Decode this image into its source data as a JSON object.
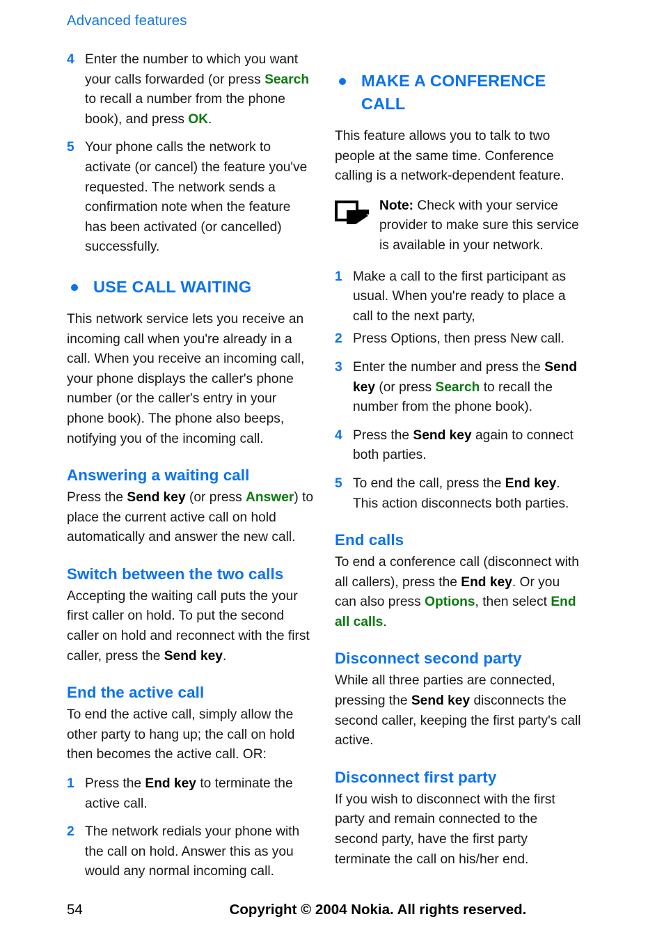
{
  "document": {
    "running_head": "Advanced features",
    "page_number": "54",
    "copyright": "Copyright © 2004 Nokia. All rights reserved.",
    "colors": {
      "heading_blue": "#0b72ee",
      "running_head_blue": "#1577e0",
      "softkey_green": "#0a7a10",
      "body_black": "#181818",
      "page_background": "#ffffff"
    }
  },
  "left_column": {
    "continued_steps": [
      {
        "number": "4",
        "segments": [
          {
            "text": "Enter the number to which you want your calls forwarded (or press ",
            "style": "normal"
          },
          {
            "text": "Search",
            "style": "green"
          },
          {
            "text": " to recall a number from the phone book), and press ",
            "style": "normal"
          },
          {
            "text": "OK",
            "style": "green"
          },
          {
            "text": ".",
            "style": "normal"
          }
        ]
      },
      {
        "number": "5",
        "segments": [
          {
            "text": "Your phone calls the network to activate (or cancel) the feature you've requested. The network sends a confirmation note when the feature has been activated (or cancelled) successfully.",
            "style": "normal"
          }
        ]
      }
    ],
    "section": {
      "title": "USE CALL WAITING",
      "intro": "This network service lets you receive an incoming call when you're already in a call. When you receive an incoming call, your phone displays the caller's phone number (or the caller's entry in your phone book). The phone also beeps, notifying you of the incoming call.",
      "subsections": [
        {
          "heading": "Answering a waiting call",
          "segments": [
            {
              "text": "Press the ",
              "style": "normal"
            },
            {
              "text": "Send key",
              "style": "bold"
            },
            {
              "text": " (or press ",
              "style": "normal"
            },
            {
              "text": "Answer",
              "style": "green"
            },
            {
              "text": ") to place the current active call on hold automatically and answer the new call.",
              "style": "normal"
            }
          ]
        },
        {
          "heading": "Switch between the two calls",
          "segments": [
            {
              "text": "Accepting the waiting call puts the your first caller on hold. To put the second caller on hold and reconnect with the first caller, press the ",
              "style": "normal"
            },
            {
              "text": "Send key",
              "style": "bold"
            },
            {
              "text": ".",
              "style": "normal"
            }
          ]
        },
        {
          "heading": "End the active call",
          "segments": [
            {
              "text": "To end the active call, simply allow the other party to hang up; the call on hold then becomes the active call. OR:",
              "style": "normal"
            }
          ]
        }
      ],
      "end_active_call_steps": [
        {
          "number": "1",
          "segments": [
            {
              "text": "Press the ",
              "style": "normal"
            },
            {
              "text": "End key",
              "style": "bold"
            },
            {
              "text": " to terminate the active call.",
              "style": "normal"
            }
          ]
        },
        {
          "number": "2",
          "segments": [
            {
              "text": "The network redials your phone with the call on hold. Answer this as you would any normal incoming call.",
              "style": "normal"
            }
          ]
        }
      ]
    }
  },
  "right_column": {
    "section": {
      "title": "MAKE A CONFERENCE CALL",
      "intro": "This feature allows you to talk to two people at the same time. Conference calling is a network-dependent feature.",
      "note": {
        "icon": "note-arrow-icon",
        "label": "Note:",
        "text": " Check with your service provider to make sure this service is available in your network."
      },
      "steps": [
        {
          "number": "1",
          "segments": [
            {
              "text": "Make a call to the first participant as usual. When you're ready to place a call to the next party,",
              "style": "normal"
            }
          ]
        },
        {
          "number": "2",
          "segments": [
            {
              "text": "Press Options, then press New call.",
              "style": "normal"
            }
          ]
        },
        {
          "number": "3",
          "segments": [
            {
              "text": "Enter the number and press the ",
              "style": "normal"
            },
            {
              "text": "Send key",
              "style": "bold"
            },
            {
              "text": " (or press ",
              "style": "normal"
            },
            {
              "text": "Search",
              "style": "green"
            },
            {
              "text": " to recall the number from the phone book).",
              "style": "normal"
            }
          ]
        },
        {
          "number": "4",
          "segments": [
            {
              "text": "Press the ",
              "style": "normal"
            },
            {
              "text": "Send key",
              "style": "bold"
            },
            {
              "text": " again to connect both parties.",
              "style": "normal"
            }
          ]
        },
        {
          "number": "5",
          "segments": [
            {
              "text": "To end the call, press the ",
              "style": "normal"
            },
            {
              "text": "End key",
              "style": "bold"
            },
            {
              "text": ". This action disconnects both parties.",
              "style": "normal"
            }
          ]
        }
      ],
      "subsections": [
        {
          "heading": "End calls",
          "segments": [
            {
              "text": "To end a conference call (disconnect with all callers), press the ",
              "style": "normal"
            },
            {
              "text": "End key",
              "style": "bold"
            },
            {
              "text": ". Or you can also press ",
              "style": "normal"
            },
            {
              "text": "Options",
              "style": "green"
            },
            {
              "text": ", then select ",
              "style": "normal"
            },
            {
              "text": "End all calls",
              "style": "green"
            },
            {
              "text": ".",
              "style": "normal"
            }
          ]
        },
        {
          "heading": "Disconnect second party",
          "segments": [
            {
              "text": "While all three parties are connected, pressing the ",
              "style": "normal"
            },
            {
              "text": "Send key",
              "style": "bold"
            },
            {
              "text": " disconnects the second caller, keeping the first party's call active.",
              "style": "normal"
            }
          ]
        },
        {
          "heading": "Disconnect first party",
          "segments": [
            {
              "text": "If you wish to disconnect with the first party and remain connected to the second party, have the first party terminate the call on his/her end.",
              "style": "normal"
            }
          ]
        }
      ]
    }
  }
}
